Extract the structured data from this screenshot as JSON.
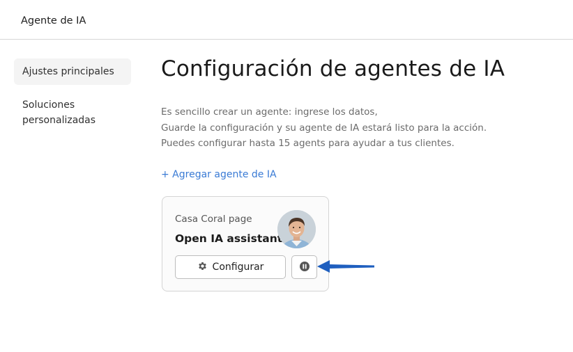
{
  "header": {
    "title": "Agente de IA"
  },
  "sidebar": {
    "items": [
      {
        "label": "Ajustes principales",
        "active": true
      },
      {
        "label": "Soluciones personalizadas",
        "active": false
      }
    ]
  },
  "main": {
    "title": "Configuración de agentes de IA",
    "description": [
      "Es sencillo crear un agente: ingrese los datos,",
      "Guarde la configuración y su agente de IA estará listo para la acción.",
      "Puedes configurar hasta 15 agents para ayudar a tus clientes."
    ],
    "add_link": "+ Agregar agente de IA"
  },
  "agent_card": {
    "page_name": "Casa Coral page",
    "agent_name": "Open IA assistant",
    "configure_label": "Configurar",
    "configure_icon": "gear-icon",
    "pause_icon": "pause-icon"
  },
  "colors": {
    "link": "#3a7bd5",
    "arrow": "#1f5fbf",
    "border": "#d6d6d6"
  }
}
